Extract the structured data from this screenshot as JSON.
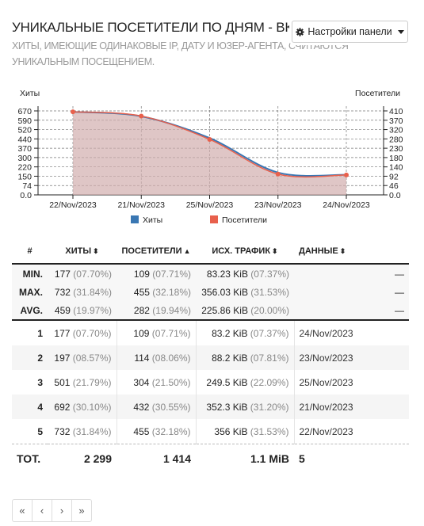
{
  "header": {
    "title": "УНИКАЛЬНЫЕ ПОСЕТИТЕЛИ ПО ДНЯМ - ВКЛЮЧАЯ СПАЙДЕРЫ",
    "subtitle": "ХИТЫ, ИМЕЮЩИЕ ОДИНАКОВЫЕ IP, ДАТУ И ЮЗЕР-АГЕНТА, СЧИТАЮТСЯ УНИКАЛЬНЫМ ПОСЕЩЕНИЕМ.",
    "settings_label": "Настройки панели"
  },
  "chart_data": {
    "type": "area",
    "categories": [
      "22/Nov/2023",
      "21/Nov/2023",
      "25/Nov/2023",
      "23/Nov/2023",
      "24/Nov/2023"
    ],
    "series": [
      {
        "name": "Хиты",
        "values": [
          732,
          692,
          501,
          197,
          177
        ],
        "color": "#3a77b3"
      },
      {
        "name": "Посетители",
        "values": [
          455,
          432,
          304,
          114,
          109
        ],
        "color": "#e8604c"
      }
    ],
    "left_axis": {
      "label": "Хиты",
      "ticks": [
        "670",
        "590",
        "520",
        "440",
        "370",
        "300",
        "220",
        "150",
        "74",
        "0.0"
      ],
      "max": 740
    },
    "right_axis": {
      "label": "Посетители",
      "ticks": [
        "410",
        "370",
        "320",
        "280",
        "230",
        "180",
        "140",
        "92",
        "46",
        "0.0"
      ],
      "max": 460
    },
    "grid": true,
    "legend": "bottom"
  },
  "table": {
    "headers": {
      "index": "#",
      "hits": "ХИТЫ",
      "visitors": "ПОСЕТИТЕЛИ",
      "traffic": "ИСХ. ТРАФИК",
      "data": "ДАННЫЕ"
    },
    "summary": [
      {
        "label": "MIN.",
        "hits": "177",
        "hits_pct": "(07.70%)",
        "visitors": "109",
        "visitors_pct": "(07.71%)",
        "traffic": "83.23 KiB",
        "traffic_pct": "(07.37%)",
        "data": "—"
      },
      {
        "label": "MAX.",
        "hits": "732",
        "hits_pct": "(31.84%)",
        "visitors": "455",
        "visitors_pct": "(32.18%)",
        "traffic": "356.03 KiB",
        "traffic_pct": "(31.53%)",
        "data": "—"
      },
      {
        "label": "AVG.",
        "hits": "459",
        "hits_pct": "(19.97%)",
        "visitors": "282",
        "visitors_pct": "(19.94%)",
        "traffic": "225.86 KiB",
        "traffic_pct": "(20.00%)",
        "data": "—"
      }
    ],
    "rows": [
      {
        "index": "1",
        "hits": "177",
        "hits_pct": "(07.70%)",
        "visitors": "109",
        "visitors_pct": "(07.71%)",
        "traffic": "83.2 KiB",
        "traffic_pct": "(07.37%)",
        "data": "24/Nov/2023"
      },
      {
        "index": "2",
        "hits": "197",
        "hits_pct": "(08.57%)",
        "visitors": "114",
        "visitors_pct": "(08.06%)",
        "traffic": "88.2 KiB",
        "traffic_pct": "(07.81%)",
        "data": "23/Nov/2023"
      },
      {
        "index": "3",
        "hits": "501",
        "hits_pct": "(21.79%)",
        "visitors": "304",
        "visitors_pct": "(21.50%)",
        "traffic": "249.5 KiB",
        "traffic_pct": "(22.09%)",
        "data": "25/Nov/2023"
      },
      {
        "index": "4",
        "hits": "692",
        "hits_pct": "(30.10%)",
        "visitors": "432",
        "visitors_pct": "(30.55%)",
        "traffic": "352.3 KiB",
        "traffic_pct": "(31.20%)",
        "data": "21/Nov/2023"
      },
      {
        "index": "5",
        "hits": "732",
        "hits_pct": "(31.84%)",
        "visitors": "455",
        "visitors_pct": "(32.18%)",
        "traffic": "356 KiB",
        "traffic_pct": "(31.53%)",
        "data": "22/Nov/2023"
      }
    ],
    "total": {
      "label": "TOT.",
      "hits": "2 299",
      "visitors": "1 414",
      "traffic": "1.1 MiB",
      "data": "5"
    }
  },
  "pagination": {
    "first": "«",
    "prev": "‹",
    "next": "›",
    "last": "»"
  }
}
